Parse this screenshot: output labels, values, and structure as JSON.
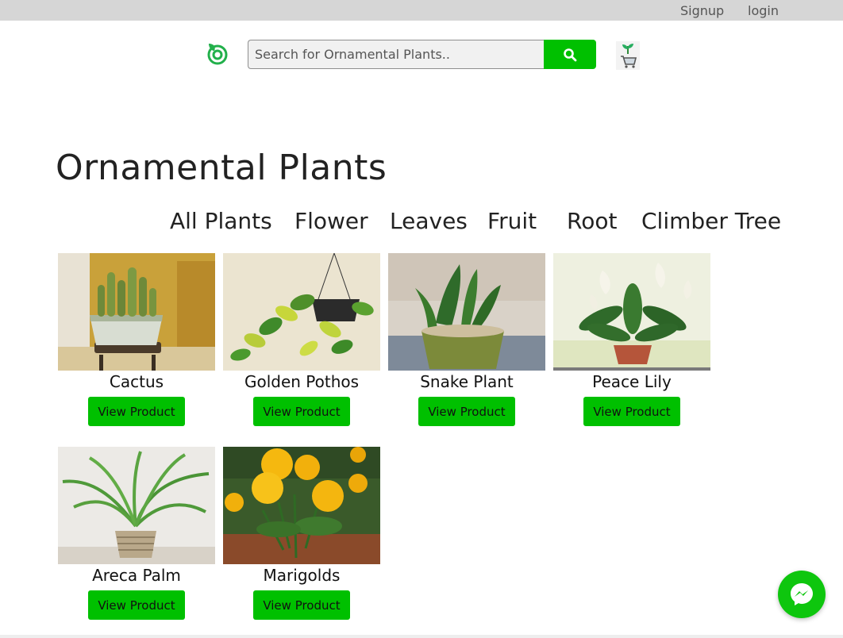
{
  "topbar": {
    "signup": "Signup",
    "login": "login"
  },
  "header": {
    "logo_icon": "leaf-logo-icon",
    "search_placeholder": "Search for Ornamental Plants..",
    "search_icon": "search-icon",
    "cart_icon": "plant-cart-icon"
  },
  "page": {
    "title": "Ornamental Plants"
  },
  "categories": [
    "All Plants",
    "Flower",
    "Leaves",
    "Fruit",
    "Root",
    "Climber Tree"
  ],
  "products": [
    {
      "name": "Cactus",
      "button": "View Product"
    },
    {
      "name": "Golden Pothos",
      "button": "View Product"
    },
    {
      "name": "Snake Plant",
      "button": "View Product"
    },
    {
      "name": "Peace Lily",
      "button": "View Product"
    },
    {
      "name": "Areca Palm",
      "button": "View Product"
    },
    {
      "name": "Marigolds",
      "button": "View Product"
    }
  ],
  "chat": {
    "icon": "messenger-icon"
  },
  "colors": {
    "accent": "#00c000",
    "topbar": "#d6d6d6"
  }
}
